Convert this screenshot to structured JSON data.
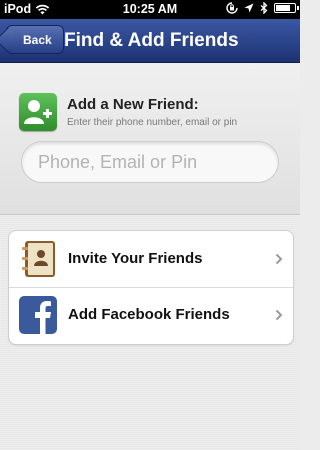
{
  "status_bar": {
    "carrier": "iPod",
    "time": "10:25 AM",
    "icons": [
      "wifi-icon",
      "rotation-lock-icon",
      "location-icon",
      "bluetooth-icon",
      "battery-icon"
    ]
  },
  "nav": {
    "back_label": "Back",
    "title": "Find & Add Friends"
  },
  "add_friend": {
    "title": "Add a New Friend:",
    "subtitle": "Enter their phone number, email or pin",
    "placeholder": "Phone, Email or Pin",
    "value": ""
  },
  "options": [
    {
      "label": "Invite Your Friends",
      "icon": "address-book-icon"
    },
    {
      "label": "Add Facebook Friends",
      "icon": "facebook-icon"
    }
  ],
  "colors": {
    "nav_bar": "#2a418a",
    "add_icon": "#3fa63c",
    "facebook": "#3b5a9c"
  }
}
